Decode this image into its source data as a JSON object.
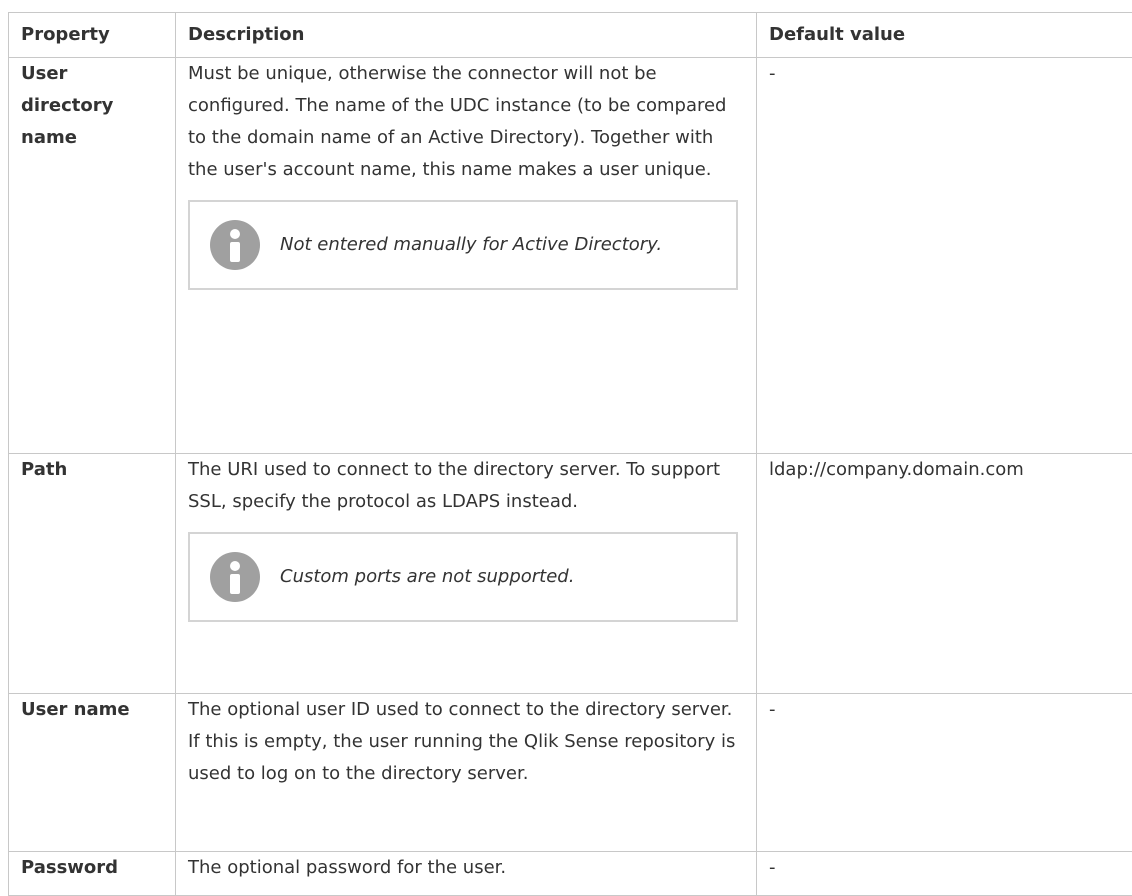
{
  "table": {
    "headers": [
      "Property",
      "Description",
      "Default value"
    ],
    "rows": [
      {
        "property": "User directory name",
        "description": "Must be unique, otherwise the connector will not be configured. The name of the UDC instance (to be compared to the domain name of an Active Directory). Together with the user's account name, this name makes a user unique.",
        "note": "Not entered manually for Active Directory.",
        "default": "-"
      },
      {
        "property": "Path",
        "description": "The URI used to connect to the directory server. To support SSL, specify the protocol as LDAPS instead.",
        "note": "Custom ports are not supported.",
        "default": "ldap://company.domain.com"
      },
      {
        "property": "User name",
        "description": "The optional user ID used to connect to the directory server. If this is empty, the user running the Qlik Sense repository is used to log on to the directory server.",
        "default": "-"
      },
      {
        "property": "Password",
        "description": "The optional password for the user.",
        "default": "-"
      }
    ]
  },
  "icons": {
    "note": "info-icon"
  },
  "colors": {
    "border": "#c8c8c8",
    "icon": "#a0a0a0",
    "text": "#333333"
  }
}
